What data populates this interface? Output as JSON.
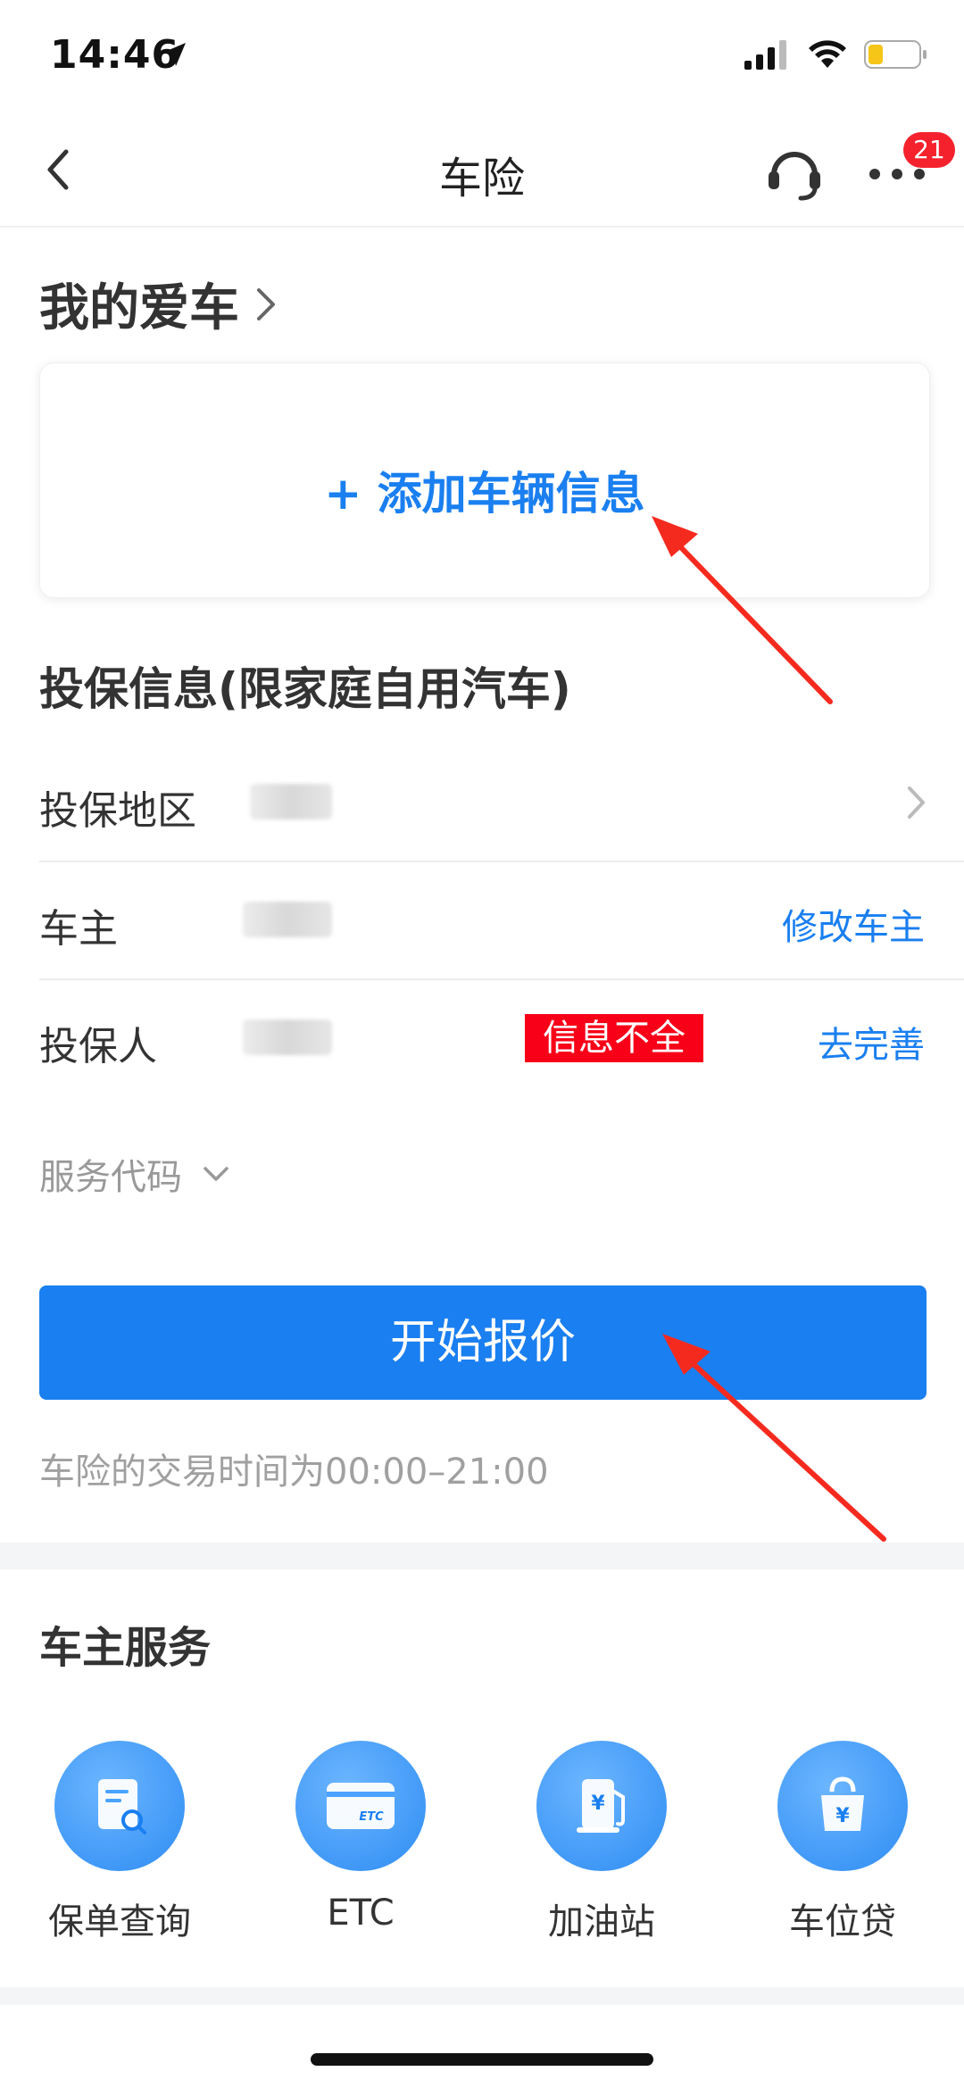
{
  "status": {
    "time": "14:46"
  },
  "nav": {
    "title": "车险",
    "badge": "21"
  },
  "my_car": {
    "title": "我的爱车",
    "add_label": "+ 添加车辆信息"
  },
  "insurance": {
    "section_title": "投保信息(限家庭自用汽车)",
    "rows": [
      {
        "label": "投保地区"
      },
      {
        "label": "车主",
        "action": "修改车主"
      },
      {
        "label": "投保人",
        "warning": "信息不全",
        "action": "去完善"
      }
    ],
    "service_code": "服务代码"
  },
  "quote_button": "开始报价",
  "trade_time": "车险的交易时间为00:00–21:00",
  "owner_services": {
    "title": "车主服务",
    "items": [
      {
        "label": "保单查询",
        "icon": "policy-search-icon"
      },
      {
        "label": "ETC",
        "icon": "etc-card-icon"
      },
      {
        "label": "加油站",
        "icon": "gas-station-icon"
      },
      {
        "label": "车位贷",
        "icon": "money-bag-icon"
      }
    ]
  },
  "colors": {
    "accent": "#1a7ff0",
    "warning_bg": "#f80018",
    "annotation_arrow": "#f52a1f"
  }
}
